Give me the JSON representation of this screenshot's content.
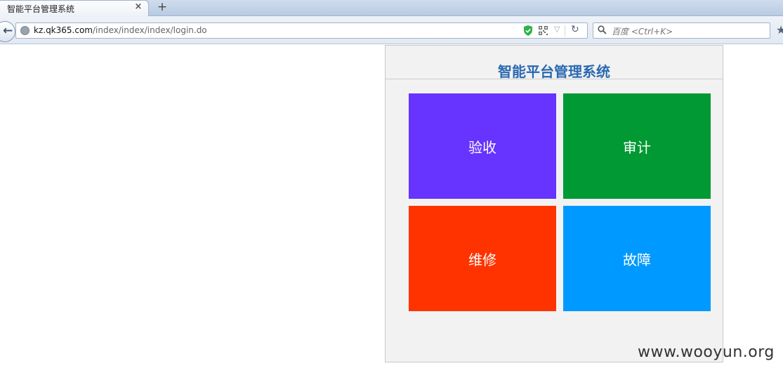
{
  "browser": {
    "tab_title": "智能平台管理系统",
    "tab_close": "×",
    "new_tab": "+",
    "url_domain": "kz.qk365.com",
    "url_path": "/index/index/index/login.do",
    "search_placeholder": "百度 <Ctrl+K>"
  },
  "page": {
    "title": "智能平台管理系统",
    "tiles": [
      {
        "label": "验收",
        "color": "#6633ff"
      },
      {
        "label": "审计",
        "color": "#009933"
      },
      {
        "label": "维修",
        "color": "#ff3300"
      },
      {
        "label": "故障",
        "color": "#0099ff"
      }
    ]
  },
  "watermark": "www.wooyun.org",
  "colors": {
    "title": "#2a69b0",
    "panel_bg": "#f2f2f2"
  }
}
